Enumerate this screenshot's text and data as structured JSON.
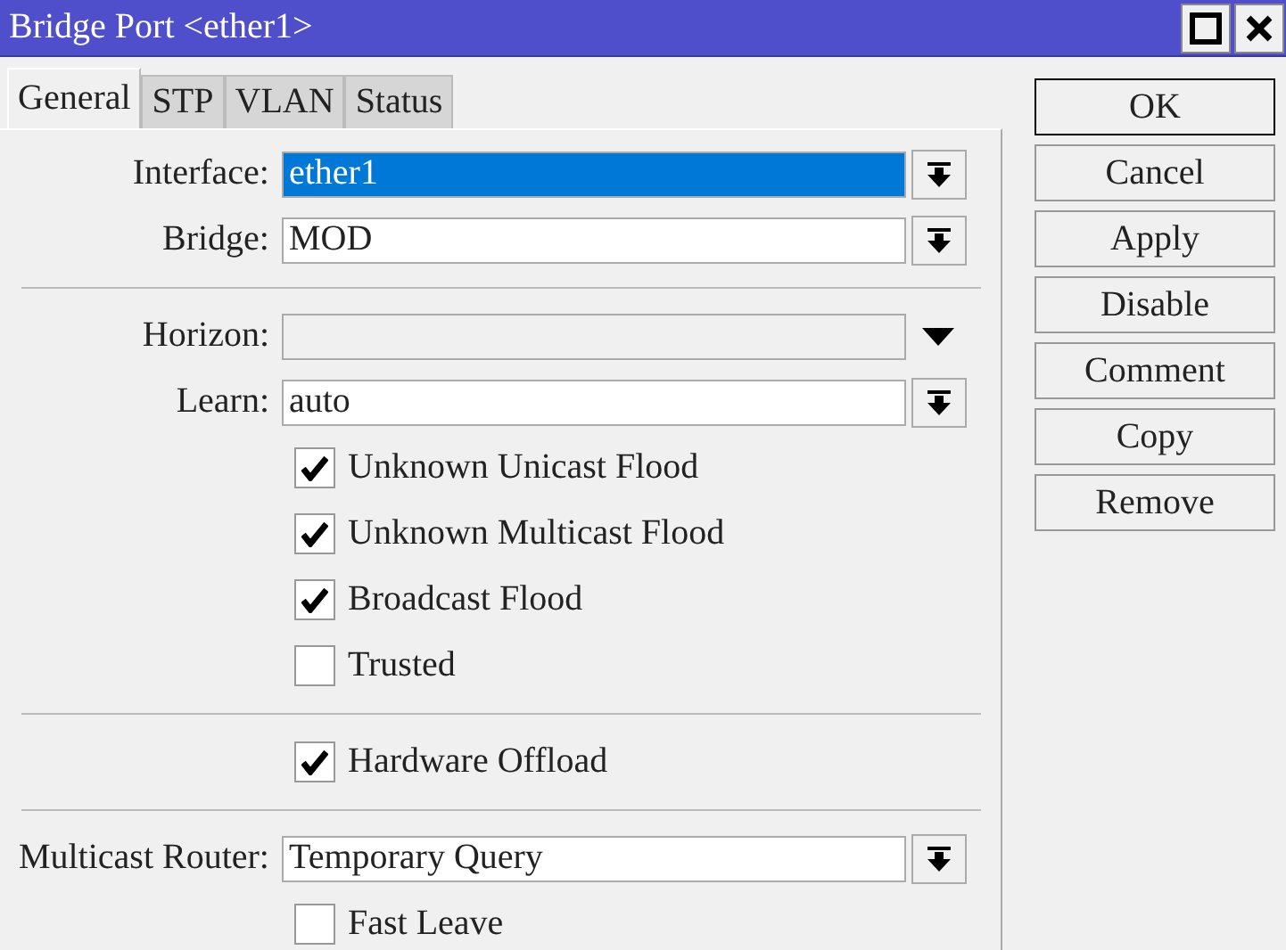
{
  "window": {
    "title": "Bridge Port <ether1>"
  },
  "tabs": [
    {
      "label": "General",
      "selected": true
    },
    {
      "label": "STP",
      "selected": false
    },
    {
      "label": "VLAN",
      "selected": false
    },
    {
      "label": "Status",
      "selected": false
    }
  ],
  "fields": [
    {
      "kind": "select",
      "label": "Interface:",
      "value": "ether1",
      "selected": true
    },
    {
      "kind": "select",
      "label": "Bridge:",
      "value": "MOD",
      "selected": false
    },
    {
      "kind": "divider"
    },
    {
      "kind": "combo",
      "label": "Horizon:"
    },
    {
      "kind": "select",
      "label": "Learn:",
      "value": "auto",
      "selected": false
    },
    {
      "kind": "checkbox",
      "label": "Unknown Unicast Flood",
      "checked": true
    },
    {
      "kind": "checkbox",
      "label": "Unknown Multicast Flood",
      "checked": true
    },
    {
      "kind": "checkbox",
      "label": "Broadcast Flood",
      "checked": true
    },
    {
      "kind": "checkbox",
      "label": "Trusted",
      "checked": false
    },
    {
      "kind": "divider"
    },
    {
      "kind": "checkbox",
      "label": "Hardware Offload",
      "checked": true
    },
    {
      "kind": "divider"
    },
    {
      "kind": "select",
      "label": "Multicast Router:",
      "value": "Temporary Query",
      "selected": false
    },
    {
      "kind": "checkbox",
      "label": "Fast Leave",
      "checked": false
    }
  ],
  "buttons": [
    {
      "label": "OK",
      "default": true
    },
    {
      "label": "Cancel",
      "default": false
    },
    {
      "label": "Apply",
      "default": false
    },
    {
      "label": "Disable",
      "default": false
    },
    {
      "label": "Comment",
      "default": false
    },
    {
      "label": "Copy",
      "default": false
    },
    {
      "label": "Remove",
      "default": false
    }
  ]
}
